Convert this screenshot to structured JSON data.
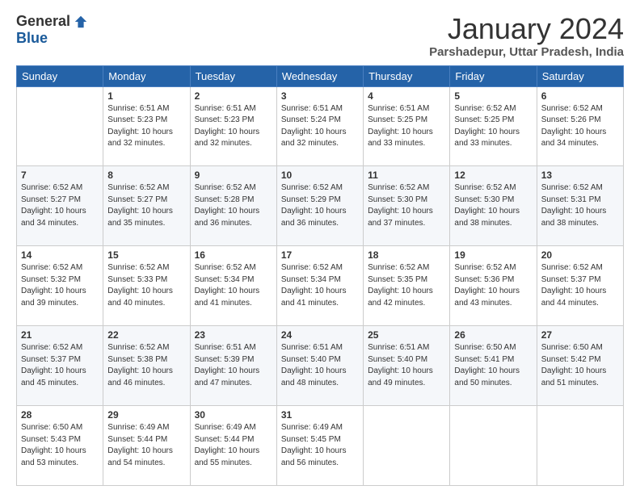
{
  "logo": {
    "general": "General",
    "blue": "Blue"
  },
  "title": "January 2024",
  "location": "Parshadepur, Uttar Pradesh, India",
  "headers": [
    "Sunday",
    "Monday",
    "Tuesday",
    "Wednesday",
    "Thursday",
    "Friday",
    "Saturday"
  ],
  "weeks": [
    [
      {
        "day": "",
        "info": ""
      },
      {
        "day": "1",
        "info": "Sunrise: 6:51 AM\nSunset: 5:23 PM\nDaylight: 10 hours\nand 32 minutes."
      },
      {
        "day": "2",
        "info": "Sunrise: 6:51 AM\nSunset: 5:23 PM\nDaylight: 10 hours\nand 32 minutes."
      },
      {
        "day": "3",
        "info": "Sunrise: 6:51 AM\nSunset: 5:24 PM\nDaylight: 10 hours\nand 32 minutes."
      },
      {
        "day": "4",
        "info": "Sunrise: 6:51 AM\nSunset: 5:25 PM\nDaylight: 10 hours\nand 33 minutes."
      },
      {
        "day": "5",
        "info": "Sunrise: 6:52 AM\nSunset: 5:25 PM\nDaylight: 10 hours\nand 33 minutes."
      },
      {
        "day": "6",
        "info": "Sunrise: 6:52 AM\nSunset: 5:26 PM\nDaylight: 10 hours\nand 34 minutes."
      }
    ],
    [
      {
        "day": "7",
        "info": "Sunrise: 6:52 AM\nSunset: 5:27 PM\nDaylight: 10 hours\nand 34 minutes."
      },
      {
        "day": "8",
        "info": "Sunrise: 6:52 AM\nSunset: 5:27 PM\nDaylight: 10 hours\nand 35 minutes."
      },
      {
        "day": "9",
        "info": "Sunrise: 6:52 AM\nSunset: 5:28 PM\nDaylight: 10 hours\nand 36 minutes."
      },
      {
        "day": "10",
        "info": "Sunrise: 6:52 AM\nSunset: 5:29 PM\nDaylight: 10 hours\nand 36 minutes."
      },
      {
        "day": "11",
        "info": "Sunrise: 6:52 AM\nSunset: 5:30 PM\nDaylight: 10 hours\nand 37 minutes."
      },
      {
        "day": "12",
        "info": "Sunrise: 6:52 AM\nSunset: 5:30 PM\nDaylight: 10 hours\nand 38 minutes."
      },
      {
        "day": "13",
        "info": "Sunrise: 6:52 AM\nSunset: 5:31 PM\nDaylight: 10 hours\nand 38 minutes."
      }
    ],
    [
      {
        "day": "14",
        "info": "Sunrise: 6:52 AM\nSunset: 5:32 PM\nDaylight: 10 hours\nand 39 minutes."
      },
      {
        "day": "15",
        "info": "Sunrise: 6:52 AM\nSunset: 5:33 PM\nDaylight: 10 hours\nand 40 minutes."
      },
      {
        "day": "16",
        "info": "Sunrise: 6:52 AM\nSunset: 5:34 PM\nDaylight: 10 hours\nand 41 minutes."
      },
      {
        "day": "17",
        "info": "Sunrise: 6:52 AM\nSunset: 5:34 PM\nDaylight: 10 hours\nand 41 minutes."
      },
      {
        "day": "18",
        "info": "Sunrise: 6:52 AM\nSunset: 5:35 PM\nDaylight: 10 hours\nand 42 minutes."
      },
      {
        "day": "19",
        "info": "Sunrise: 6:52 AM\nSunset: 5:36 PM\nDaylight: 10 hours\nand 43 minutes."
      },
      {
        "day": "20",
        "info": "Sunrise: 6:52 AM\nSunset: 5:37 PM\nDaylight: 10 hours\nand 44 minutes."
      }
    ],
    [
      {
        "day": "21",
        "info": "Sunrise: 6:52 AM\nSunset: 5:37 PM\nDaylight: 10 hours\nand 45 minutes."
      },
      {
        "day": "22",
        "info": "Sunrise: 6:52 AM\nSunset: 5:38 PM\nDaylight: 10 hours\nand 46 minutes."
      },
      {
        "day": "23",
        "info": "Sunrise: 6:51 AM\nSunset: 5:39 PM\nDaylight: 10 hours\nand 47 minutes."
      },
      {
        "day": "24",
        "info": "Sunrise: 6:51 AM\nSunset: 5:40 PM\nDaylight: 10 hours\nand 48 minutes."
      },
      {
        "day": "25",
        "info": "Sunrise: 6:51 AM\nSunset: 5:40 PM\nDaylight: 10 hours\nand 49 minutes."
      },
      {
        "day": "26",
        "info": "Sunrise: 6:50 AM\nSunset: 5:41 PM\nDaylight: 10 hours\nand 50 minutes."
      },
      {
        "day": "27",
        "info": "Sunrise: 6:50 AM\nSunset: 5:42 PM\nDaylight: 10 hours\nand 51 minutes."
      }
    ],
    [
      {
        "day": "28",
        "info": "Sunrise: 6:50 AM\nSunset: 5:43 PM\nDaylight: 10 hours\nand 53 minutes."
      },
      {
        "day": "29",
        "info": "Sunrise: 6:49 AM\nSunset: 5:44 PM\nDaylight: 10 hours\nand 54 minutes."
      },
      {
        "day": "30",
        "info": "Sunrise: 6:49 AM\nSunset: 5:44 PM\nDaylight: 10 hours\nand 55 minutes."
      },
      {
        "day": "31",
        "info": "Sunrise: 6:49 AM\nSunset: 5:45 PM\nDaylight: 10 hours\nand 56 minutes."
      },
      {
        "day": "",
        "info": ""
      },
      {
        "day": "",
        "info": ""
      },
      {
        "day": "",
        "info": ""
      }
    ]
  ]
}
